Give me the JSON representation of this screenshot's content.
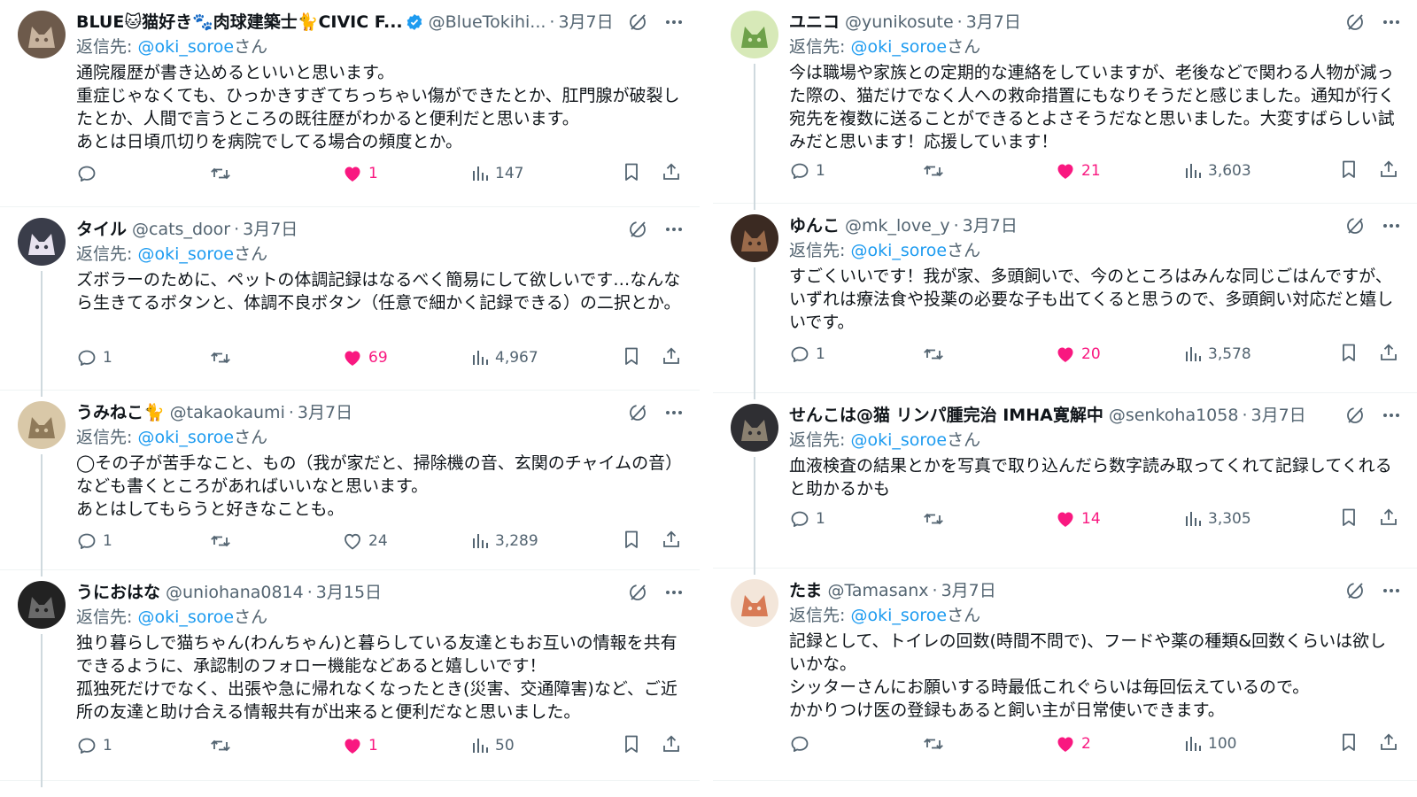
{
  "colors": {
    "accent": "#1d9bf0",
    "like": "#f91880",
    "secondary_text": "#536471",
    "text": "#0f1419",
    "divider": "#eff3f4"
  },
  "icons": {
    "reply": "speech-bubble-icon",
    "retweet": "retweet-arrows-icon",
    "like": "heart-icon",
    "views": "bar-chart-icon",
    "bookmark": "bookmark-icon",
    "share": "share-upload-icon",
    "grok": "grok-slash-icon",
    "more": "ellipsis-icon",
    "verified": "verified-badge-icon"
  },
  "reply_prefix": "返信先: ",
  "reply_suffix": "さん",
  "left": [
    {
      "name": "BLUE🐱猫好き🐾肉球建築士🐈CIVIC F...",
      "verified": true,
      "handle": "@BlueTokihi...",
      "dot": "·",
      "date": "3月7日",
      "reply_to": "@oki_soroe",
      "text": "通院履歴が書き込めるといいと思います。\n重症じゃなくても、ひっかきすぎてちっちゃい傷ができたとか、肛門腺が破裂したとか、人間で言うところの既往歴がわかると便利だと思います。\nあとは日頃爪切りを病院でしてる場合の頻度とか。",
      "replies": "",
      "likes": "1",
      "liked": true,
      "views": "147"
    },
    {
      "name": "タイル",
      "verified": false,
      "handle": "@cats_door",
      "dot": "·",
      "date": "3月7日",
      "reply_to": "@oki_soroe",
      "text": "ズボラーのために、ペットの体調記録はなるべく簡易にして欲しいです…なんなら生きてるボタンと、体調不良ボタン（任意で細かく記録できる）の二択とか。",
      "replies": "1",
      "likes": "69",
      "liked": true,
      "views": "4,967"
    },
    {
      "name": "うみねこ🐈",
      "verified": false,
      "handle": "@takaokaumi",
      "dot": "·",
      "date": "3月7日",
      "reply_to": "@oki_soroe",
      "text": "◯その子が苦手なこと、もの（我が家だと、掃除機の音、玄関のチャイムの音）なども書くところがあればいいなと思います。\nあとはしてもらうと好きなことも。",
      "replies": "1",
      "likes": "24",
      "liked": false,
      "views": "3,289"
    },
    {
      "name": "うにおはな",
      "verified": false,
      "handle": "@uniohana0814",
      "dot": "·",
      "date": "3月15日",
      "reply_to": "@oki_soroe",
      "text": "独り暮らしで猫ちゃん(わんちゃん)と暮らしている友達ともお互いの情報を共有できるように、承認制のフォロー機能などあると嬉しいです！\n孤独死だけでなく、出張や急に帰れなくなったとき(災害、交通障害)など、ご近所の友達と助け合える情報共有が出来ると便利だなと思いました。",
      "replies": "1",
      "likes": "1",
      "liked": true,
      "views": "50"
    }
  ],
  "right": [
    {
      "name": "ユニコ",
      "verified": false,
      "handle": "@yunikosute",
      "dot": "·",
      "date": "3月7日",
      "reply_to": "@oki_soroe",
      "text": "今は職場や家族との定期的な連絡をしていますが、老後などで関わる人物が減った際の、猫だけでなく人への救命措置にもなりそうだと感じました。通知が行く宛先を複数に送ることができるとよさそうだなと思いました。大変すばらしい試みだと思います！応援しています！",
      "replies": "1",
      "likes": "21",
      "liked": true,
      "views": "3,603"
    },
    {
      "name": "ゆんこ",
      "verified": false,
      "handle": "@mk_love_y",
      "dot": "·",
      "date": "3月7日",
      "reply_to": "@oki_soroe",
      "text": "すごくいいです！我が家、多頭飼いで、今のところはみんな同じごはんですが、いずれは療法食や投薬の必要な子も出てくると思うので、多頭飼い対応だと嬉しいです。",
      "replies": "1",
      "likes": "20",
      "liked": true,
      "views": "3,578"
    },
    {
      "name": "せんこは@猫 リンパ腫完治 IMHA寛解中",
      "verified": false,
      "handle": "@senkoha1058",
      "dot": "·",
      "date": "3月7日",
      "reply_to": "@oki_soroe",
      "text": "血液検査の結果とかを写真で取り込んだら数字読み取ってくれて記録してくれると助かるかも",
      "replies": "1",
      "likes": "14",
      "liked": true,
      "views": "3,305"
    },
    {
      "name": "たま",
      "verified": false,
      "handle": "@Tamasanx",
      "dot": "·",
      "date": "3月7日",
      "reply_to": "@oki_soroe",
      "text": "記録として、トイレの回数(時間不問で)、フードや薬の種類&回数くらいは欲しいかな。\nシッターさんにお願いする時最低これぐらいは毎回伝えているので。\nかかりつけ医の登録もあると飼い主が日常使いできます。",
      "replies": "",
      "likes": "2",
      "liked": true,
      "views": "100"
    }
  ]
}
